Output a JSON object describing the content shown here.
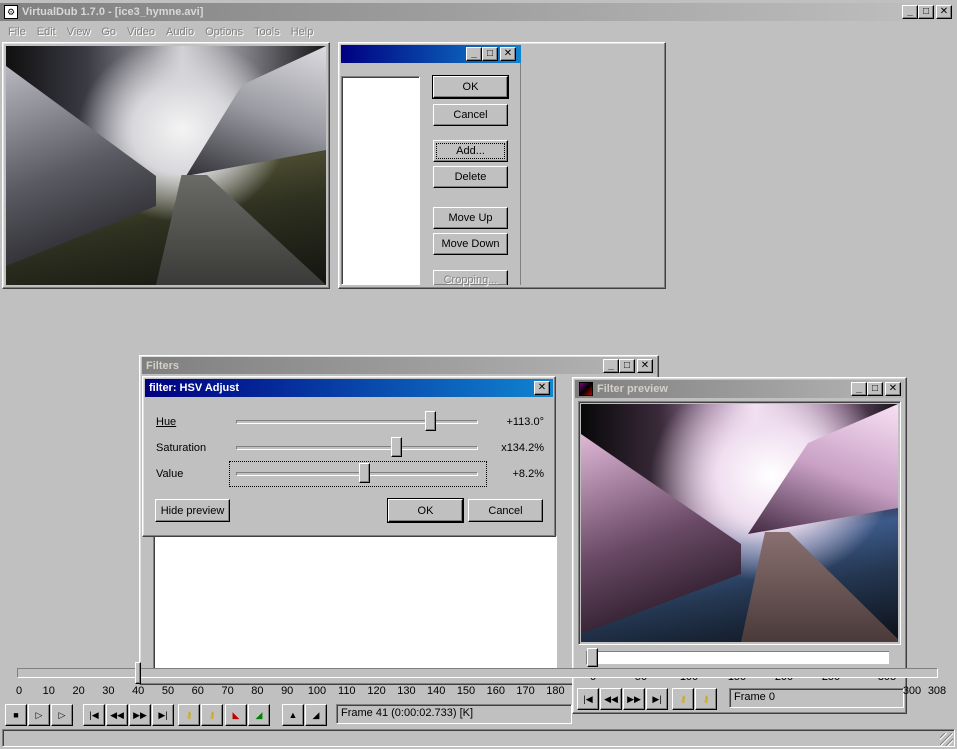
{
  "main_window": {
    "title": "VirtualDub 1.7.0 - [ice3_hymne.avi]",
    "menu": [
      "File",
      "Edit",
      "View",
      "Go",
      "Video",
      "Audio",
      "Options",
      "Tools",
      "Help"
    ]
  },
  "filters_list_dialog": {
    "buttons": {
      "ok": "OK",
      "cancel": "Cancel",
      "add": "Add...",
      "delete": "Delete",
      "move_up": "Move Up",
      "move_down": "Move Down",
      "cropping": "Cropping..."
    }
  },
  "filters_window": {
    "title": "Filters"
  },
  "hsv_dialog": {
    "title": "filter: HSV Adjust",
    "sliders": [
      {
        "label": "Hue",
        "value_text": "+113.0°",
        "level": 0.8
      },
      {
        "label": "Saturation",
        "value_text": "x134.2%",
        "level": 0.66
      },
      {
        "label": "Value",
        "value_text": "+8.2%",
        "level": 0.53
      }
    ],
    "buttons": {
      "hide_preview": "Hide preview",
      "ok": "OK",
      "cancel": "Cancel"
    }
  },
  "filter_preview": {
    "title": "Filter preview",
    "ticks": [
      "0",
      "50",
      "100",
      "150",
      "200",
      "250",
      "308"
    ],
    "frame_status": "Frame 0"
  },
  "timeline": {
    "ticks": [
      "0",
      "10",
      "20",
      "30",
      "40",
      "50",
      "60",
      "70",
      "80",
      "90",
      "100",
      "110",
      "120",
      "130",
      "140",
      "150",
      "160",
      "170",
      "180",
      "300",
      "308"
    ],
    "position_frame": 41,
    "total_frames": 308,
    "status": "Frame 41 (0:00:02.733) [K]"
  },
  "colors": {
    "active_title": "#000080",
    "inactive_title": "#808080",
    "face": "#c0c0c0"
  }
}
